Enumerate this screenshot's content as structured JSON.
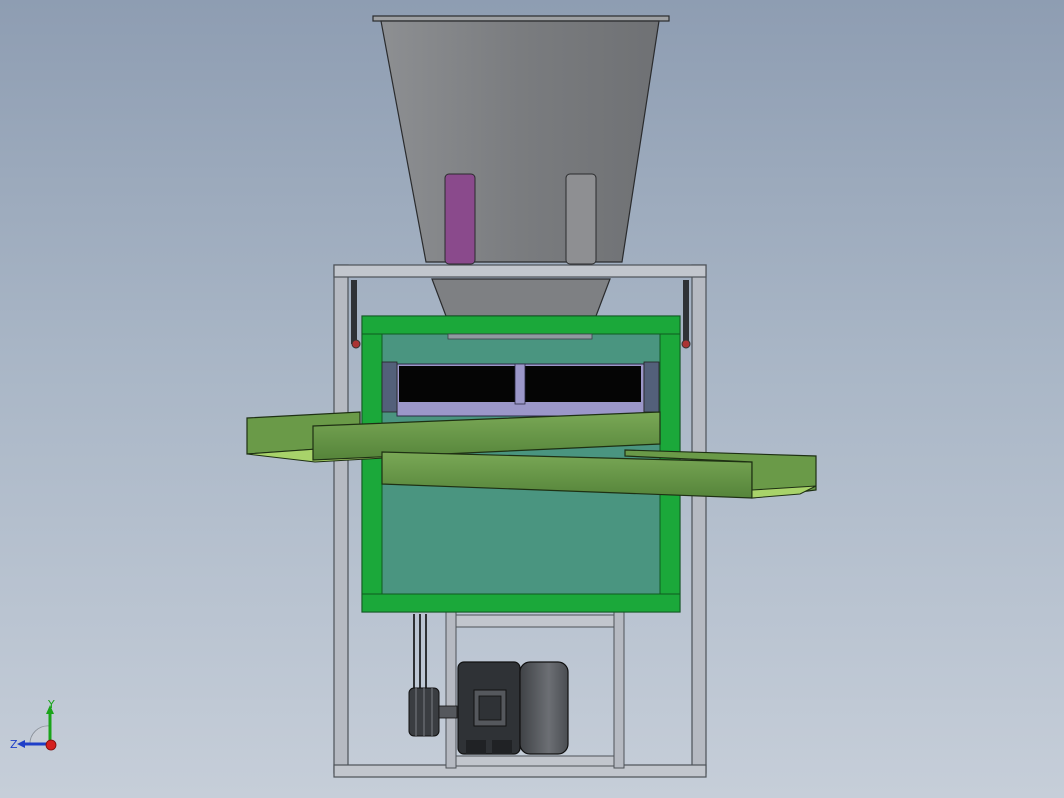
{
  "viewport": {
    "background_top": "#8e9db2",
    "background_bottom": "#c6ced9"
  },
  "model": {
    "frame_color": "#b6bac2",
    "hopper_color": "#7f8184",
    "sieve_body_color": "#4a9580",
    "sieve_frame_color": "#1ba83a",
    "chute_color": "#6a9a48",
    "screen_color": "#9b97c9",
    "motor_color": "#5b5e63",
    "pipe_left_color": "#8a4a8c",
    "pipe_right_color": "#8e8f92"
  },
  "triad": {
    "x_label": "",
    "y_label": "Y",
    "z_label": "Z",
    "y_color": "#1aa41a",
    "z_color": "#1f3fc8",
    "x_color": "#d42020"
  }
}
